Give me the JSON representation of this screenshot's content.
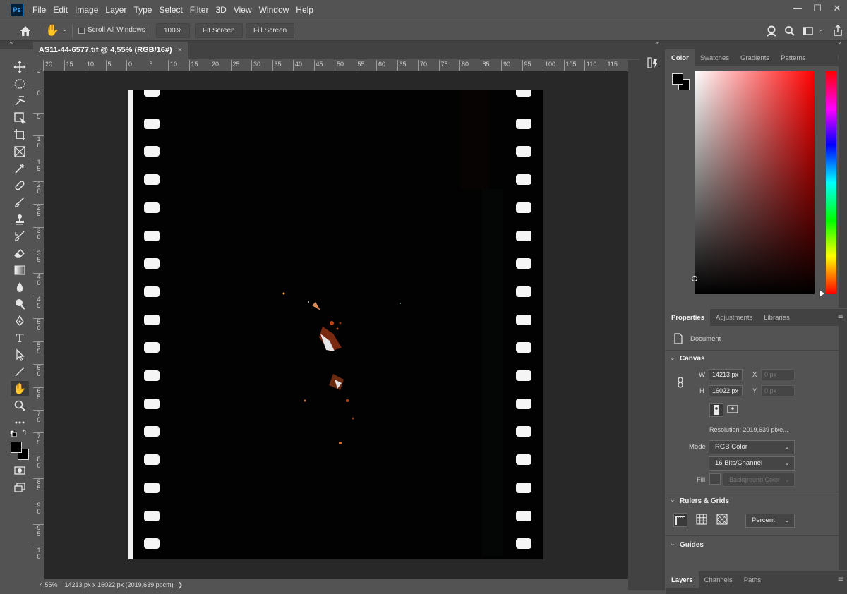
{
  "app": {
    "logo": "Ps",
    "menu": [
      "File",
      "Edit",
      "Image",
      "Layer",
      "Type",
      "Select",
      "Filter",
      "3D",
      "View",
      "Window",
      "Help"
    ],
    "window_controls": [
      "—",
      "☐",
      "✕"
    ]
  },
  "options": {
    "scroll_all_windows": "Scroll All Windows",
    "zoom_button": "100%",
    "fit_screen": "Fit Screen",
    "fill_screen": "Fill Screen"
  },
  "document": {
    "tab_title": "AS11-44-6577.tif @ 4,55% (RGB/16#)",
    "tab_close": "×",
    "ruler_h": [
      "20",
      "15",
      "10",
      "5",
      "0",
      "5",
      "10",
      "15",
      "20",
      "25",
      "30",
      "35",
      "40",
      "45",
      "50",
      "55",
      "60",
      "65",
      "70",
      "75",
      "80",
      "85",
      "90",
      "95",
      "100",
      "105",
      "110",
      "115"
    ],
    "ruler_v": [
      "5",
      "0",
      "5",
      "1 0",
      "1 5",
      "2 0",
      "2 5",
      "3 0",
      "3 5",
      "4 0",
      "4 5",
      "5 0",
      "5 5",
      "6 0",
      "6 5",
      "7 0",
      "7 5",
      "8 0",
      "8 5",
      "9 0",
      "9 5",
      "1 0"
    ],
    "zoom": "4,55%",
    "status": "14213 px x 16022 px (2019,639 ppcm)",
    "status_arrow": "❯"
  },
  "color_panel": {
    "tabs": [
      "Color",
      "Swatches",
      "Gradients",
      "Patterns"
    ],
    "selected_tab": "Color",
    "hue_color": "#ff0000"
  },
  "properties_panel": {
    "tabs": [
      "Properties",
      "Adjustments",
      "Libraries"
    ],
    "selected_tab": "Properties",
    "type_label": "Document",
    "canvas_section": "Canvas",
    "w_label": "W",
    "w_value": "14213 px",
    "h_label": "H",
    "h_value": "16022 px",
    "x_label": "X",
    "x_value": "0 px",
    "y_label": "Y",
    "y_value": "0 px",
    "resolution": "Resolution:  2019,639  pixe...",
    "mode_label": "Mode",
    "mode_value": "RGB Color",
    "depth_value": "16 Bits/Channel",
    "fill_label": "Fill",
    "fill_value": "Background Color",
    "rulers_section": "Rulers & Grids",
    "units_value": "Percent",
    "guides_section": "Guides"
  },
  "layers_panel": {
    "tabs": [
      "Layers",
      "Channels",
      "Paths"
    ],
    "selected_tab": "Layers"
  }
}
